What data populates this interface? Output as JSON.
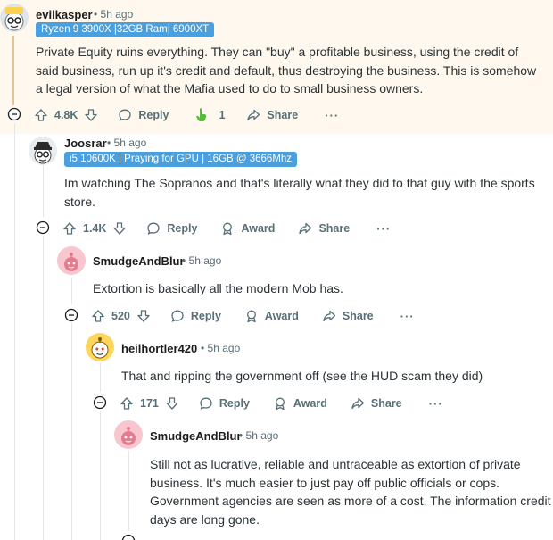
{
  "colors": {
    "highlight_bg": "#fff8ee",
    "flair_bg": "#4a9fdc",
    "award_hand": "#58b93d",
    "meta": "#576f76"
  },
  "comments": [
    {
      "author": "evilkasper",
      "time": "5h ago",
      "flair": "Ryzen 9 3900X |32GB Ram| 6900XT",
      "body": "Private Equity ruins everything. They can \"buy\" a profitable business, using the credit of said business, run up it's credit and default, thus destroying the business. This is somehow a legal version of what the Mafia used to do to small business owners.",
      "votes": "4.8K",
      "reply": "Reply",
      "award_count": "1",
      "share": "Share",
      "more": "···",
      "avatar_icon": "snoo-glasses-avatar-icon"
    },
    {
      "author": "Joosrar",
      "time": "5h ago",
      "flair": "i5 10600K | Praying for GPU | 16GB @ 3666Mhz",
      "body": "Im watching The Sopranos and that's literally what they did to that guy with the sports store.",
      "votes": "1.4K",
      "reply": "Reply",
      "award": "Award",
      "share": "Share",
      "more": "···",
      "avatar_icon": "snoo-hat-avatar-icon"
    },
    {
      "author": "SmudgeAndBlur",
      "time": "5h ago",
      "body": "Extortion is basically all the modern Mob has.",
      "votes": "520",
      "reply": "Reply",
      "award": "Award",
      "share": "Share",
      "more": "···",
      "avatar_icon": "snoo-pink-avatar-icon"
    },
    {
      "author": "heilhortler420",
      "time": "5h ago",
      "body": "That and ripping the government off (see the HUD scam they did)",
      "votes": "171",
      "reply": "Reply",
      "award": "Award",
      "share": "Share",
      "more": "···",
      "avatar_icon": "snoo-yellow-avatar-icon"
    },
    {
      "author": "SmudgeAndBlur",
      "time": "5h ago",
      "body": "Still not as lucrative, reliable and untraceable as extortion of private business. It's much easier to just pay off public officials or cops. Government agencies are seen as more of a cost. The information credit days are long gone.",
      "avatar_icon": "snoo-pink-avatar-icon"
    }
  ]
}
